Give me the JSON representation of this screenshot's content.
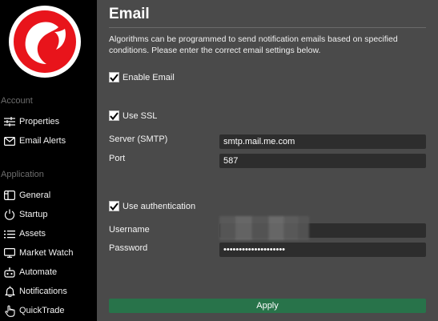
{
  "sidebar": {
    "logo_icon": "app-logo",
    "sections": [
      {
        "label": "Account",
        "items": [
          {
            "label": "Properties",
            "icon": "sliders-icon"
          },
          {
            "label": "Email Alerts",
            "icon": "envelope-icon"
          }
        ]
      },
      {
        "label": "Application",
        "items": [
          {
            "label": "General",
            "icon": "layout-icon"
          },
          {
            "label": "Startup",
            "icon": "power-icon"
          },
          {
            "label": "Assets",
            "icon": "list-icon"
          },
          {
            "label": "Market Watch",
            "icon": "monitor-icon"
          },
          {
            "label": "Automate",
            "icon": "robot-icon"
          },
          {
            "label": "Notifications",
            "icon": "bell-icon"
          },
          {
            "label": "QuickTrade",
            "icon": "hand-pointer-icon"
          }
        ]
      }
    ]
  },
  "main": {
    "title": "Email",
    "description": "Algorithms can be programmed to send notification emails based on specified conditions. Please enter the correct email settings below.",
    "enable_email": {
      "label": "Enable Email",
      "checked": true
    },
    "use_ssl": {
      "label": "Use SSL",
      "checked": true
    },
    "server": {
      "label": "Server (SMTP)",
      "value": "smtp.mail.me.com"
    },
    "port": {
      "label": "Port",
      "value": "587"
    },
    "use_auth": {
      "label": "Use authentication",
      "checked": true
    },
    "username": {
      "label": "Username",
      "value": ""
    },
    "password": {
      "label": "Password",
      "value": "••••••••••••••••••••"
    },
    "apply_label": "Apply"
  },
  "colors": {
    "sidebar_bg": "#000000",
    "main_bg": "#4a4a4a",
    "field_bg": "#2d2d2d",
    "apply_bg": "#28734a",
    "logo_red": "#e8141b"
  }
}
